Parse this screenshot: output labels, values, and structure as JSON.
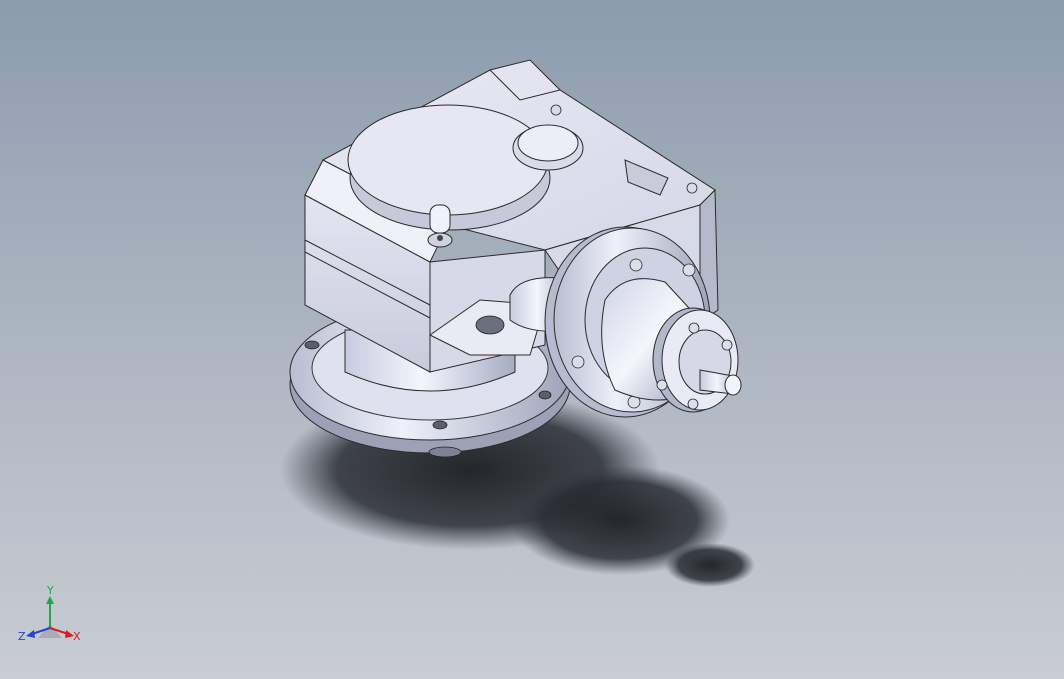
{
  "viewport": {
    "background_top": "#8c9cad",
    "background_bottom": "#c9ccd3",
    "model_description": "gearbox-3d-model"
  },
  "triad": {
    "x_label": "X",
    "y_label": "Y",
    "z_label": "Z",
    "x_color": "#d22020",
    "y_color": "#1fa84a",
    "z_color": "#2b44c8"
  }
}
